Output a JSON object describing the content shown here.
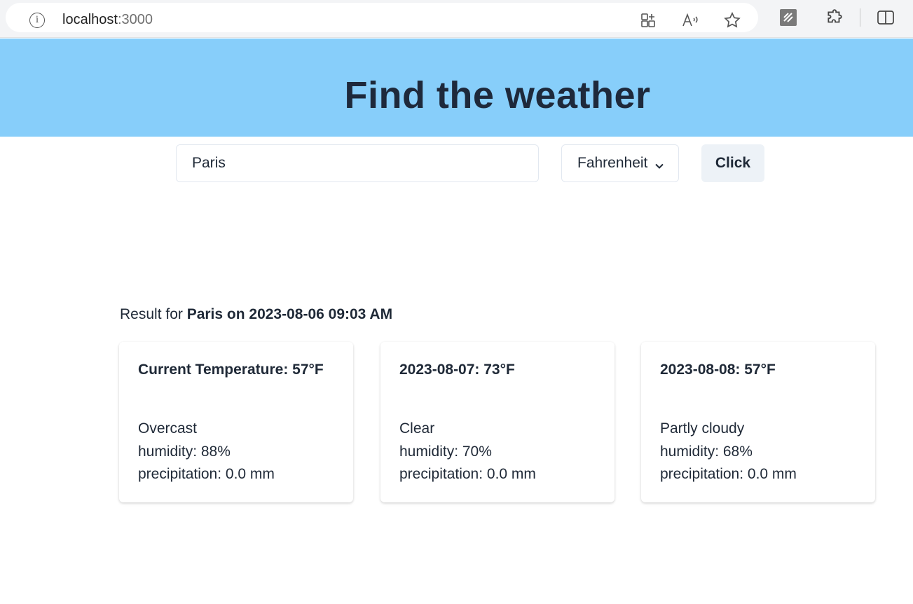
{
  "browser": {
    "url_host": "localhost",
    "url_port": ":3000",
    "icons": [
      "info-icon",
      "add-tab-icon",
      "read-aloud-icon",
      "favorite-star-icon",
      "extension-notes-icon",
      "extensions-puzzle-icon",
      "split-screen-icon"
    ]
  },
  "header": {
    "title": "Find the weather"
  },
  "search": {
    "city_value": "Paris",
    "unit_selected": "Fahrenheit",
    "submit_label": "Click"
  },
  "result": {
    "prefix": "Result for ",
    "emphasis": "Paris on 2023-08-06 09:03 AM"
  },
  "cards": [
    {
      "title": "Current Temperature: 57°F",
      "condition": "Overcast",
      "humidity": "humidity: 88%",
      "precipitation": "precipitation: 0.0 mm"
    },
    {
      "title": "2023-08-07: 73°F",
      "condition": "Clear",
      "humidity": "humidity: 70%",
      "precipitation": "precipitation: 0.0 mm"
    },
    {
      "title": "2023-08-08: 57°F",
      "condition": "Partly cloudy",
      "humidity": "humidity: 68%",
      "precipitation": "precipitation: 0.0 mm"
    }
  ],
  "colors": {
    "header_bg": "#87cefa",
    "text": "#1f2937",
    "button_bg": "#edf2f7"
  }
}
